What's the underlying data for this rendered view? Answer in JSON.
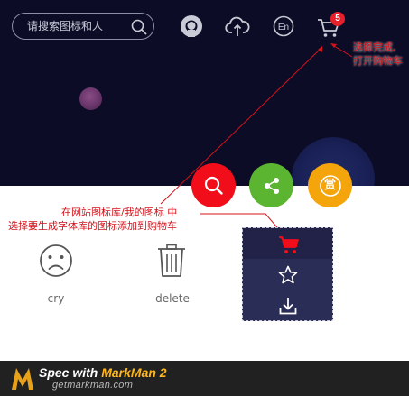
{
  "header": {
    "search": {
      "placeholder": "请搜索图标和人"
    },
    "cart": {
      "badge_count": "5"
    },
    "icons": [
      "search-icon",
      "github-icon",
      "upload-cloud-icon",
      "language-en-icon",
      "shopping-cart-icon"
    ]
  },
  "annotations": {
    "cart_note_line1": "选择完成,",
    "cart_note_line2": "打开购物车",
    "add_note_line1": "在网站图标库/我的图标 中",
    "add_note_line2": "选择要生成字体库的图标添加到购物车"
  },
  "actions": {
    "search": "search-icon",
    "share": "share-icon",
    "reward_label": "赏"
  },
  "icon_grid": {
    "items": [
      {
        "label": "cry"
      },
      {
        "label": "delete"
      }
    ]
  },
  "popup": {
    "icons": [
      "cart-add-icon",
      "star-icon",
      "download-icon"
    ]
  },
  "footer": {
    "title_prefix": "Spec with ",
    "brand": "MarkMan 2",
    "url": "getmarkman.com"
  },
  "colors": {
    "header_bg": "#0c0c26",
    "accent_red": "#f20d1b",
    "share_green": "#5cb531",
    "reward_orange": "#f4a50c",
    "badge_red": "#e8202b"
  }
}
